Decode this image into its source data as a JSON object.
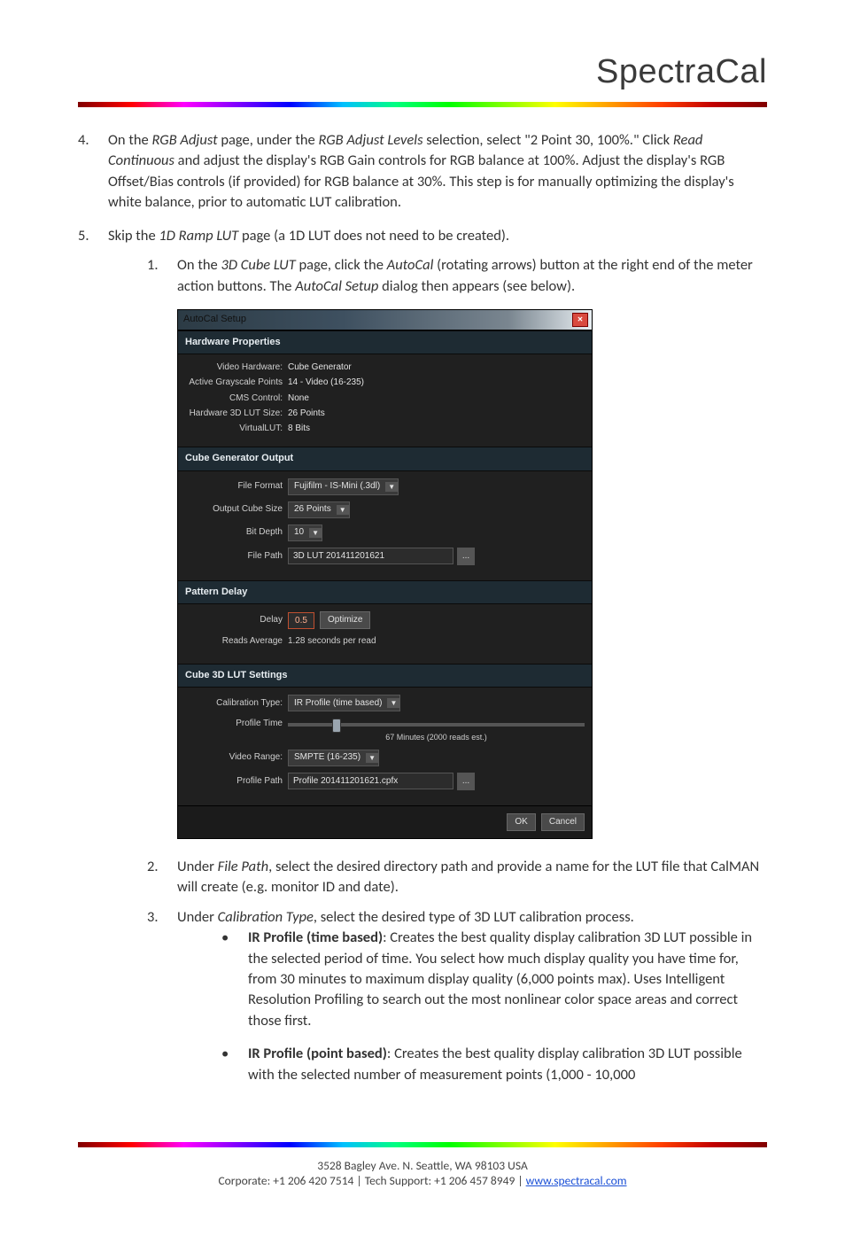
{
  "brand": "SpectraCal",
  "list": {
    "item4": {
      "num": "4.",
      "text_plain": "On the RGB Adjust page, under the RGB Adjust Levels selection, select \"2 Point 30, 100%.\" Click Read Continuous and adjust the display's RGB Gain controls for RGB balance at 100%. Adjust the display's RGB Offset/Bias controls (if provided) for RGB balance at 30%. This step is for manually optimizing the display's white balance, prior to automatic LUT calibration.",
      "t1": "On the ",
      "i1": "RGB Adjust",
      "t2": " page, under the ",
      "i2": "RGB Adjust Levels",
      "t3": " selection, select \"2 Point 30, 100%.\" Click ",
      "i3": "Read Continuous",
      "t4": " and adjust the display's RGB Gain controls for RGB balance at 100%. Adjust the display's RGB Offset/Bias controls (if provided) for RGB balance at 30%. This step is for manually optimizing the display's white balance, prior to automatic LUT calibration."
    },
    "item5": {
      "num": "5.",
      "t1": "Skip the ",
      "i1": "1D Ramp LUT",
      "t2": " page (a 1D LUT does not need to be created).",
      "sub1": {
        "num": "1.",
        "t1": "On the ",
        "i1": "3D Cube LUT",
        "t2": " page, click the ",
        "i2": "AutoCal",
        "t3": " (rotating arrows) button at the right end of the meter action buttons. The ",
        "i3": "AutoCal Setup",
        "t4": " dialog then appears (see below)."
      },
      "sub2": {
        "num": "2.",
        "t1": "Under ",
        "i1": "File Path",
        "t2": ", select the desired directory path and provide a name for the LUT file that CalMAN will create (e.g. monitor ID and date)."
      },
      "sub3": {
        "num": "3.",
        "t1": "Under ",
        "i1": "Calibration Type",
        "t2": ", select the desired type of 3D LUT calibration process.",
        "b1": {
          "label": "IR Profile (time based)",
          "rest": ": Creates the best quality display calibration 3D LUT possible in the selected period of time. You select how much display quality you have time for, from 30 minutes to maximum display quality (6,000 points max). Uses Intelligent Resolution Profiling to search out the most nonlinear color space areas and correct those first."
        },
        "b2": {
          "label": "IR Profile (point based)",
          "rest": ": Creates the best quality display calibration 3D LUT possible with the selected number of measurement points (1,000 - 10,000"
        }
      }
    }
  },
  "dialog": {
    "title": "AutoCal Setup",
    "close_glyph": "✕",
    "hw_header": "Hardware Properties",
    "hw": {
      "l1": "Video Hardware:",
      "v1": "Cube Generator",
      "l2": "Active Grayscale Points",
      "v2": "14 - Video (16-235)",
      "l3": "CMS Control:",
      "v3": "None",
      "l4": "Hardware 3D LUT Size:",
      "v4": "26 Points",
      "l5": "VirtualLUT:",
      "v5": "8 Bits"
    },
    "cgo_header": "Cube Generator Output",
    "cgo": {
      "l1": "File Format",
      "v1": "Fujifilm - IS-Mini (.3dl)",
      "l2": "Output Cube Size",
      "v2": "26 Points",
      "l3": "Bit Depth",
      "v3": "10",
      "l4": "File Path",
      "v4": "3D LUT 201411201621"
    },
    "pd_header": "Pattern Delay",
    "pd": {
      "l1": "Delay",
      "v1": "0.5",
      "optimize": "Optimize",
      "l2": "Reads Average",
      "v2": "1.28  seconds per read"
    },
    "c3_header": "Cube 3D LUT Settings",
    "c3": {
      "l1": "Calibration Type:",
      "v1": "IR Profile (time based)",
      "l2": "Profile Time",
      "caption": "67 Minutes (2000 reads est.)",
      "l3": "Video Range:",
      "v3": "SMPTE (16-235)",
      "l4": "Profile Path",
      "v4": "Profile 201411201621.cpfx"
    },
    "ok": "OK",
    "cancel": "Cancel",
    "dots": "...",
    "arrow": "▼"
  },
  "footer": {
    "addr": "3528 Bagley Ave. N. Seattle, WA 98103 USA",
    "corp": "Corporate: +1 206 420 7514",
    "sep": "   |   ",
    "tech": "Tech Support: +1 206 457 8949",
    "url": "www.spectracal.com"
  }
}
